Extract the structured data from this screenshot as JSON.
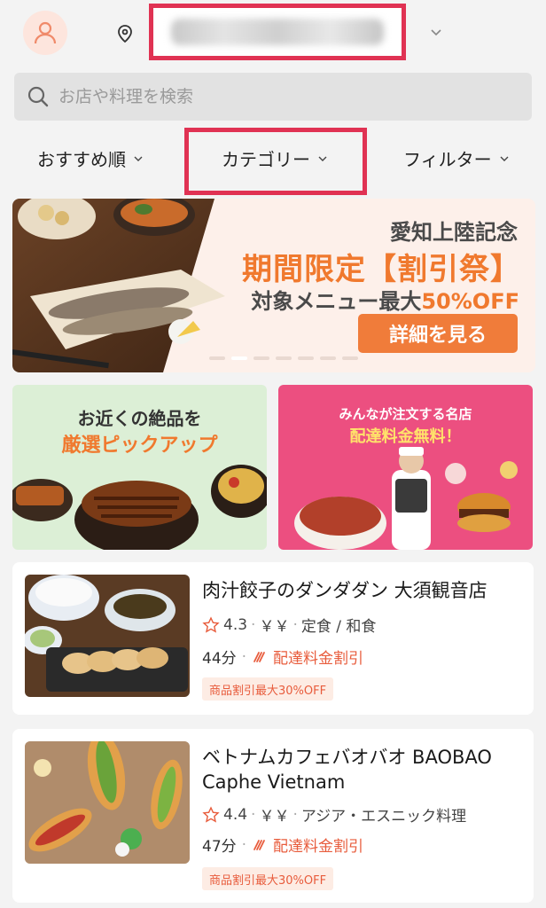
{
  "header": {
    "address_label": ""
  },
  "search": {
    "placeholder": "お店や料理を検索"
  },
  "filters": {
    "sort_label": "おすすめ順",
    "category_label": "カテゴリー",
    "filter_label": "フィルター"
  },
  "banner": {
    "line1": "愛知上陸記念",
    "line2": "期間限定【割引祭】",
    "line3_prefix": "対象メニュー最大",
    "line3_highlight": "50%OFF",
    "button_label": "詳細を見る"
  },
  "promos": {
    "left": {
      "line1": "お近くの絶品を",
      "line2": "厳選ピックアップ"
    },
    "right": {
      "line1": "みんなが注文する名店",
      "line2": "配達料金無料！"
    }
  },
  "restaurants": [
    {
      "name": "肉汁餃子のダンダダン 大須観音店",
      "rating": "4.3",
      "price": "￥￥",
      "categories": "定食 / 和食",
      "time": "44分",
      "delivery_label": "配達料金割引",
      "badge": "商品割引最大30%OFF"
    },
    {
      "name": "ベトナムカフェバオバオ BAOBAO Caphe Vietnam",
      "rating": "4.4",
      "price": "￥￥",
      "categories": "アジア・エスニック料理",
      "time": "47分",
      "delivery_label": "配達料金割引",
      "badge": "商品割引最大30%OFF"
    }
  ],
  "colors": {
    "accent": "#f0792e",
    "highlight_box": "#e03253",
    "promo_pink": "#ec4f80",
    "promo_green": "#dcefd6"
  },
  "icons": {
    "avatar": "person-icon",
    "location": "location-pin-icon",
    "search": "search-icon",
    "rating": "star-icon",
    "delivery": "delivery-bike-icon"
  }
}
